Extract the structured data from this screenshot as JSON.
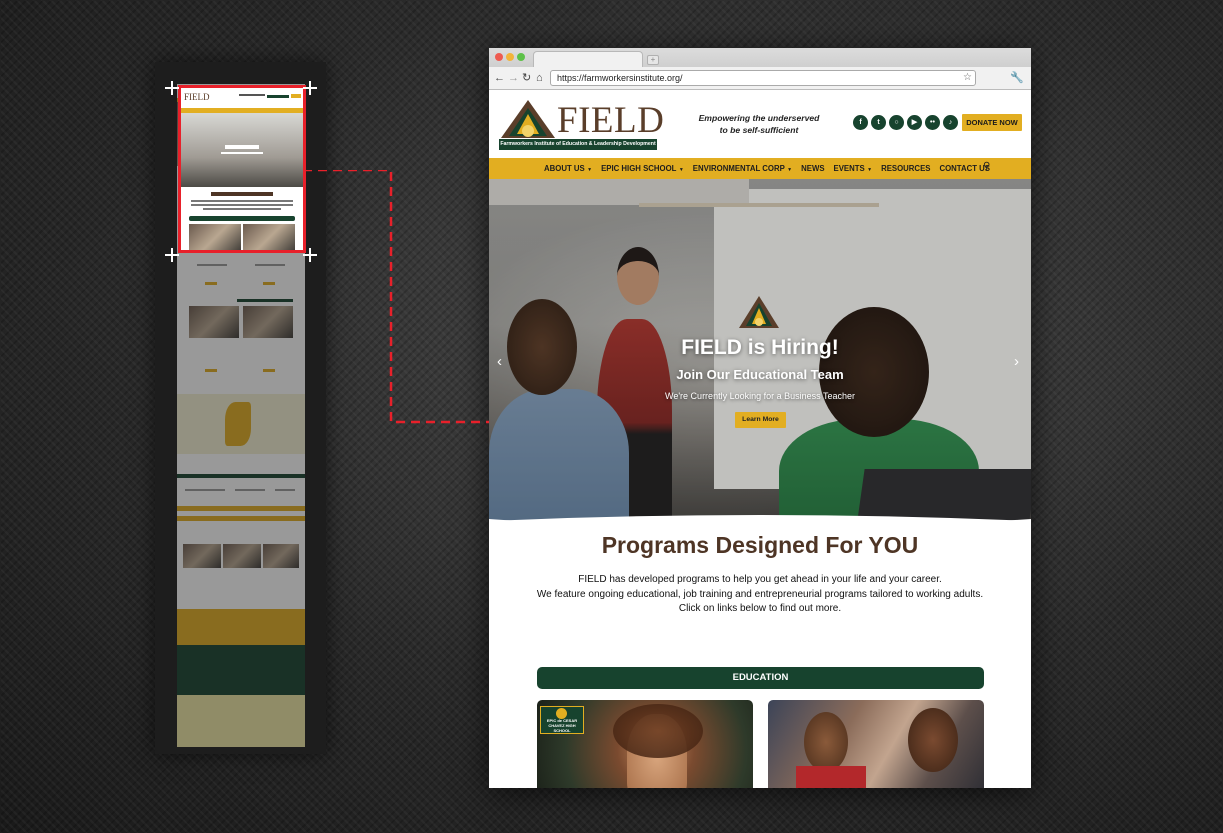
{
  "browser": {
    "url": "https://farmworkersinstitute.org/"
  },
  "header": {
    "logo_word": "FIELD",
    "logo_subtitle": "Farmworkers Institute of Education & Leadership Development",
    "tagline_line1": "Empowering the underserved",
    "tagline_line2": "to be self-sufficient",
    "donate_label": "DONATE NOW",
    "social_icons": [
      "facebook-icon",
      "twitter-icon",
      "instagram-icon",
      "youtube-icon",
      "flickr-icon",
      "tiktok-icon"
    ]
  },
  "nav": {
    "items": [
      {
        "label": "ABOUT US",
        "dropdown": true
      },
      {
        "label": "EPIC HIGH SCHOOL",
        "dropdown": true
      },
      {
        "label": "ENVIRONMENTAL CORP",
        "dropdown": true
      },
      {
        "label": "NEWS",
        "dropdown": false
      },
      {
        "label": "EVENTS",
        "dropdown": true
      },
      {
        "label": "RESOURCES",
        "dropdown": false
      },
      {
        "label": "CONTACT US",
        "dropdown": false
      }
    ]
  },
  "hero": {
    "title": "FIELD is Hiring!",
    "subtitle": "Join Our Educational Team",
    "text": "We're Currently Looking for a Business Teacher",
    "button_label": "Learn More",
    "slide_count": 4,
    "active_slide": 3
  },
  "programs": {
    "title": "Programs Designed For YOU",
    "text_line1": "FIELD has developed programs to help you get ahead in your life and your career.",
    "text_line2": "We feature ongoing educational, job training and entrepreneurial programs tailored to working adults.",
    "text_line3": "Click on links below to find out more.",
    "section_label": "EDUCATION",
    "badge_text": "EPIC de CESAR CHAVEZ HIGH SCHOOL"
  },
  "colors": {
    "brand_green": "#17432e",
    "brand_gold": "#e2ae21",
    "brand_brown": "#4e3525",
    "highlight_frame": "#e8202a"
  }
}
